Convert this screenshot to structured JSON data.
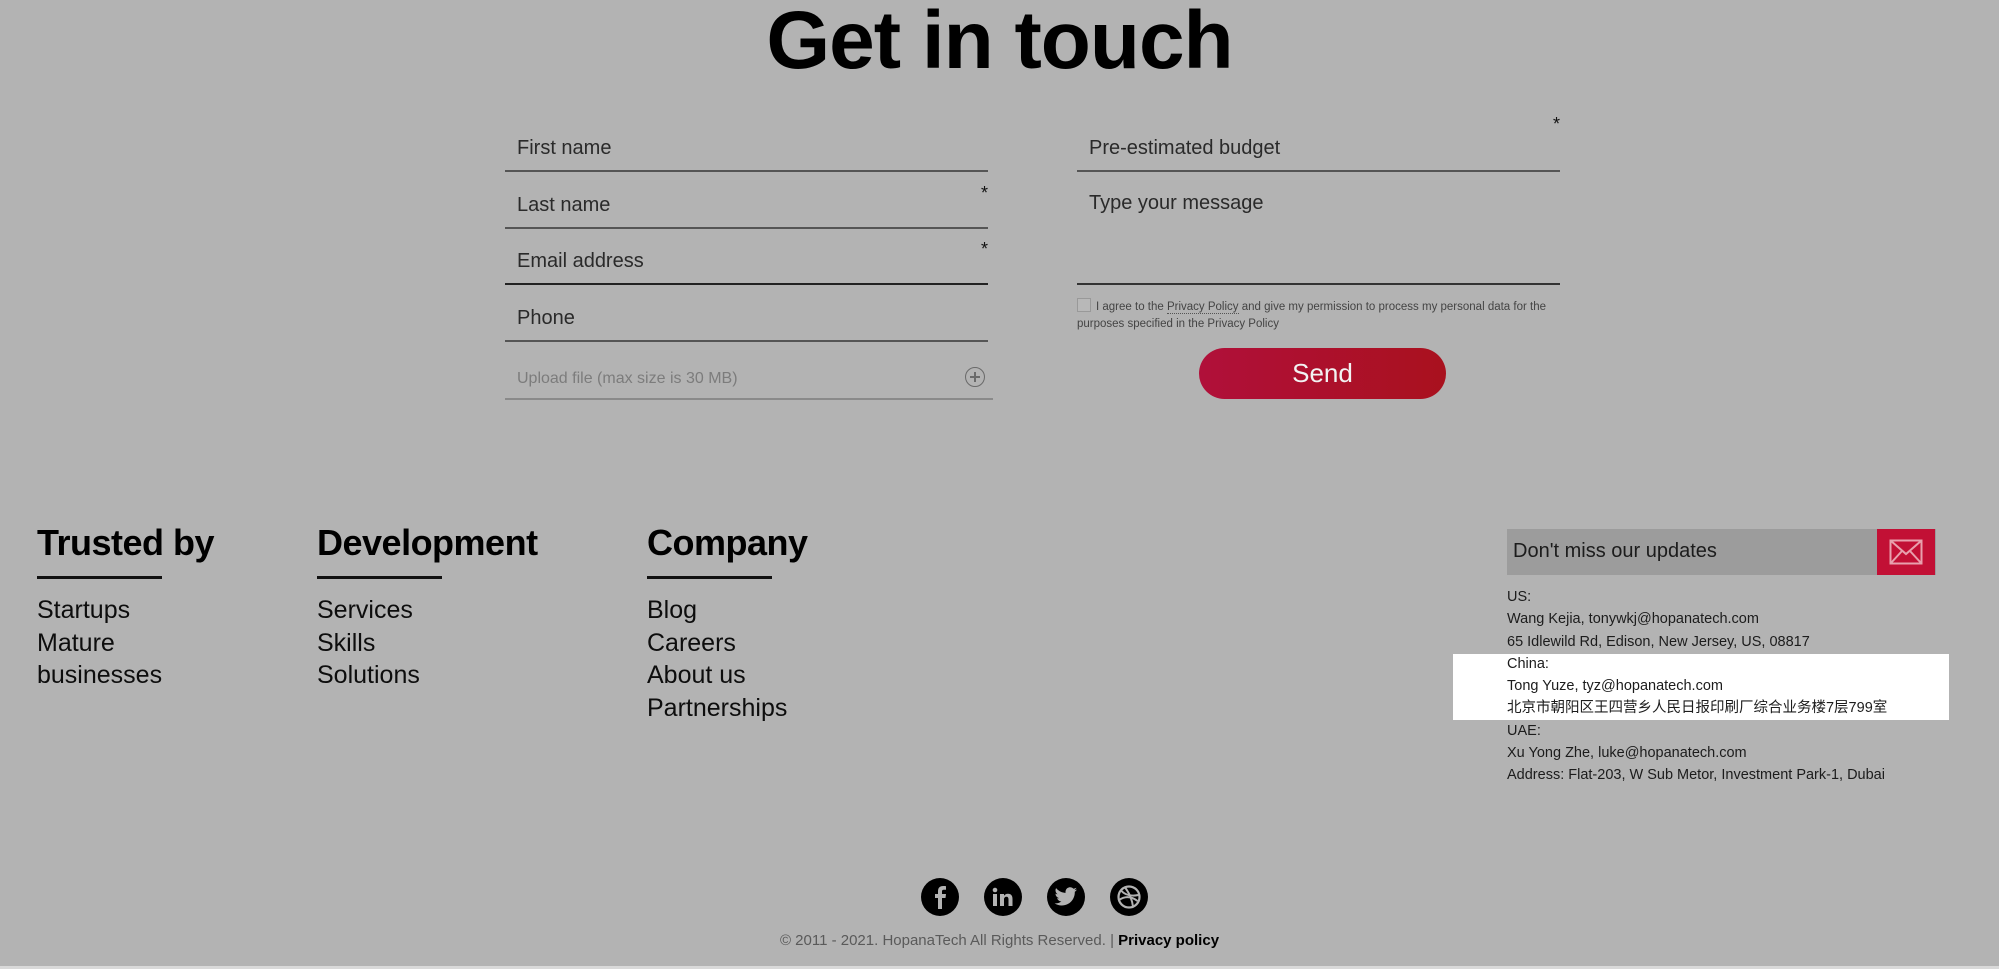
{
  "contact": {
    "title": "Get in touch",
    "left_fields": [
      {
        "placeholder": "First name",
        "required": false
      },
      {
        "placeholder": "Last name",
        "required": true
      },
      {
        "placeholder": "Email address",
        "required": true
      },
      {
        "placeholder": "Phone",
        "required": false
      }
    ],
    "upload": {
      "placeholder": "Upload file (max size is 30 MB)",
      "icon": "plus-circle-icon"
    },
    "budget": {
      "placeholder": "Pre-estimated budget",
      "required": true
    },
    "message": {
      "placeholder": "Type your message"
    },
    "required_marker": "*",
    "consent": {
      "checked": false,
      "prefix": "I agree to the ",
      "link": "Privacy Policy",
      "suffix": " and give my permission to process my personal data for the purposes specified in the Privacy Policy"
    },
    "send_label": "Send"
  },
  "footer": {
    "columns": [
      {
        "heading": "Trusted by",
        "items": [
          "Startups",
          "Mature",
          "businesses"
        ]
      },
      {
        "heading": "Development",
        "items": [
          "Services",
          "Skills",
          "Solutions"
        ]
      },
      {
        "heading": "Company",
        "items": [
          "Blog",
          "Careers",
          "About us",
          "Partnerships"
        ]
      }
    ],
    "newsletter": {
      "placeholder": "Don't miss our updates",
      "icon": "envelope-icon"
    },
    "addresses": [
      "US:",
      "Wang Kejia, tonywkj@hopanatech.com",
      "65 Idlewild Rd, Edison, New Jersey, US, 08817",
      "China:",
      "Tong Yuze, tyz@hopanatech.com",
      "北京市朝阳区王四营乡人民日报印刷厂综合业务楼7层799室",
      "UAE:",
      "Xu Yong Zhe, luke@hopanatech.com",
      "Address: Flat-203, W Sub Metor, Investment Park-1, Dubai"
    ],
    "social": [
      "facebook-icon",
      "linkedin-icon",
      "twitter-icon",
      "dribbble-icon"
    ],
    "copyright": "© 2011 - 2021. HopanaTech All Rights Reserved. | ",
    "privacy_link": "Privacy policy"
  },
  "colors": {
    "background": "#b3b3b3",
    "accent": "#c21035",
    "highlight": "#ffffff"
  }
}
